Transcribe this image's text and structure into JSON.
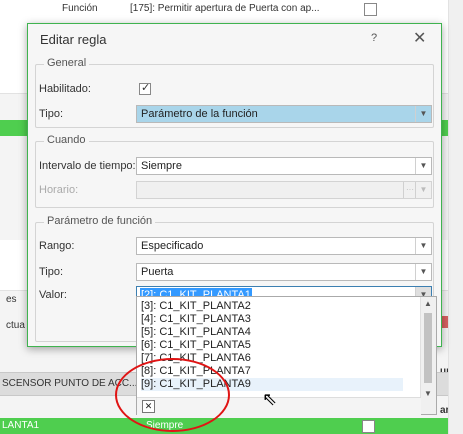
{
  "background": {
    "top_row": {
      "col1": "Función",
      "col2": "[175]: Permitir apertura de Puerta con ap..."
    },
    "left_fragments": [
      "es",
      "ctua"
    ],
    "header_cell": "SCENSOR PUNTO DE ACC...",
    "right_fragments": [
      "unes",
      "artes"
    ],
    "bottom_row": {
      "col1": "LANTA1",
      "col2": "Siempre"
    }
  },
  "dialog": {
    "title": "Editar regla",
    "help": "?",
    "close": "✕",
    "general": {
      "title": "General",
      "habilitado_label": "Habilitado:",
      "habilitado_checked": true,
      "tipo_label": "Tipo:",
      "tipo_value": "Parámetro de la función"
    },
    "cuando": {
      "title": "Cuando",
      "intervalo_label": "Intervalo de tiempo:",
      "intervalo_value": "Siempre",
      "horario_label": "Horario:",
      "horario_value": ""
    },
    "parametro": {
      "title": "Parámetro de función",
      "rango_label": "Rango:",
      "rango_value": "Especificado",
      "tipo_label": "Tipo:",
      "tipo_value": "Puerta",
      "valor_label": "Valor:",
      "valor_value": "[2]: C1_KIT_PLANTA1"
    }
  },
  "dropdown": {
    "items": [
      "[3]: C1_KIT_PLANTA2",
      "[4]: C1_KIT_PLANTA3",
      "[5]: C1_KIT_PLANTA4",
      "[6]: C1_KIT_PLANTA5",
      "[7]: C1_KIT_PLANTA6",
      "[8]: C1_KIT_PLANTA7",
      "[9]: C1_KIT_PLANTA9"
    ],
    "clear_symbol": "✕"
  },
  "colors": {
    "accent_green": "#4fce4f",
    "selection_blue": "#a9d5ea",
    "annotation_red": "#e01414"
  }
}
